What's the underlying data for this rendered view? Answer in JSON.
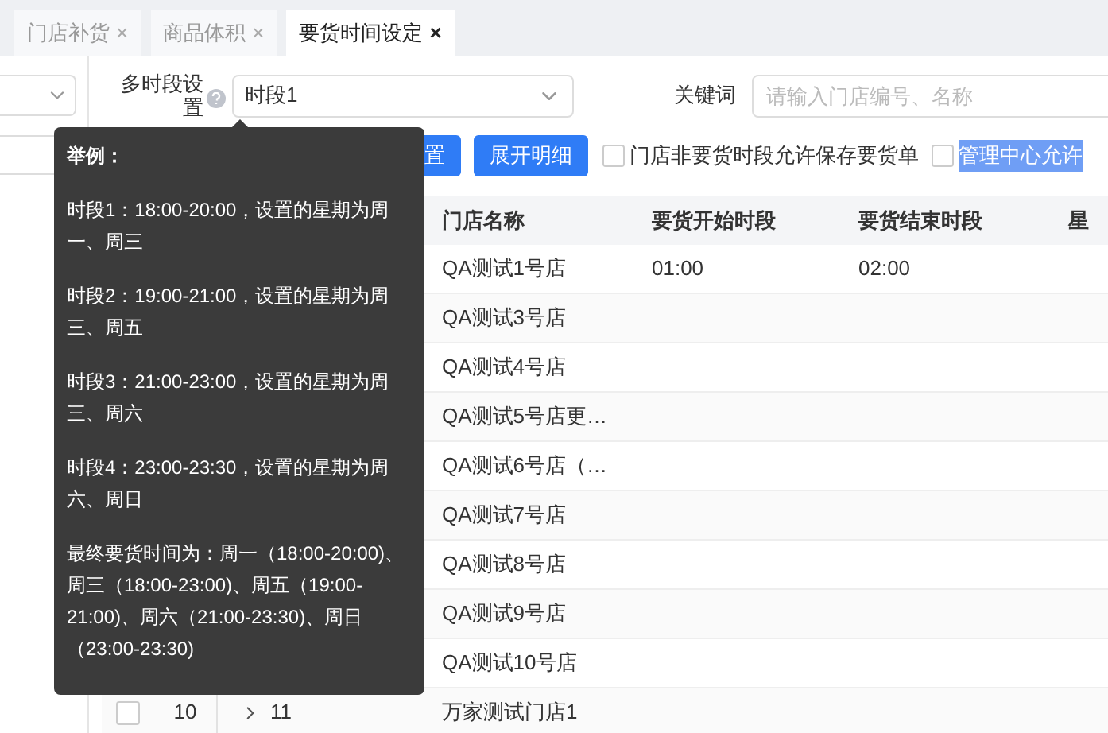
{
  "tabs": [
    {
      "label": "门店补货",
      "selected": false,
      "close": "×"
    },
    {
      "label": "商品体积",
      "selected": false,
      "close": "×"
    },
    {
      "label": "要货时间设定",
      "selected": true,
      "close": "×"
    }
  ],
  "filters": {
    "period_label": "多时段设置",
    "period_value": "时段1",
    "keyword_label": "关键词",
    "keyword_placeholder": "请输入门店编号、名称"
  },
  "buttons": [
    {
      "label": "置"
    },
    {
      "label": "展开明细"
    }
  ],
  "options": [
    {
      "label": "门店非要货时段允许保存要货单",
      "checked": false,
      "highlighted": false
    },
    {
      "label": "管理中心允许",
      "checked": false,
      "highlighted": true
    }
  ],
  "table": {
    "columns": [
      "门店名称",
      "要货开始时段",
      "要货结束时段",
      "星"
    ],
    "rows": [
      {
        "name": "QA测试1号店",
        "start": "01:00",
        "end": "02:00"
      },
      {
        "name": "QA测试3号店"
      },
      {
        "name": "QA测试4号店"
      },
      {
        "name": "QA测试5号店更…"
      },
      {
        "name": "QA测试6号店（…"
      },
      {
        "name": "QA测试7号店"
      },
      {
        "name": "QA测试8号店"
      },
      {
        "name": "QA测试9号店"
      },
      {
        "name": "QA测试10号店"
      },
      {
        "seq": "10",
        "code": "11",
        "name": "万家测试门店1",
        "checked": false
      }
    ]
  },
  "tooltip": {
    "title": "举例：",
    "paragraphs": [
      "时段1：18:00-20:00，设置的星期为周一、周三",
      "时段2：19:00-21:00，设置的星期为周三、周五",
      "时段3：21:00-23:00，设置的星期为周三、周六",
      "时段4：23:00-23:30，设置的星期为周六、周日",
      "最终要货时间为：周一（18:00-20:00)、周三（18:00-23:00)、周五（19:00-21:00)、周六（21:00-23:30)、周日（23:00-23:30)"
    ]
  }
}
